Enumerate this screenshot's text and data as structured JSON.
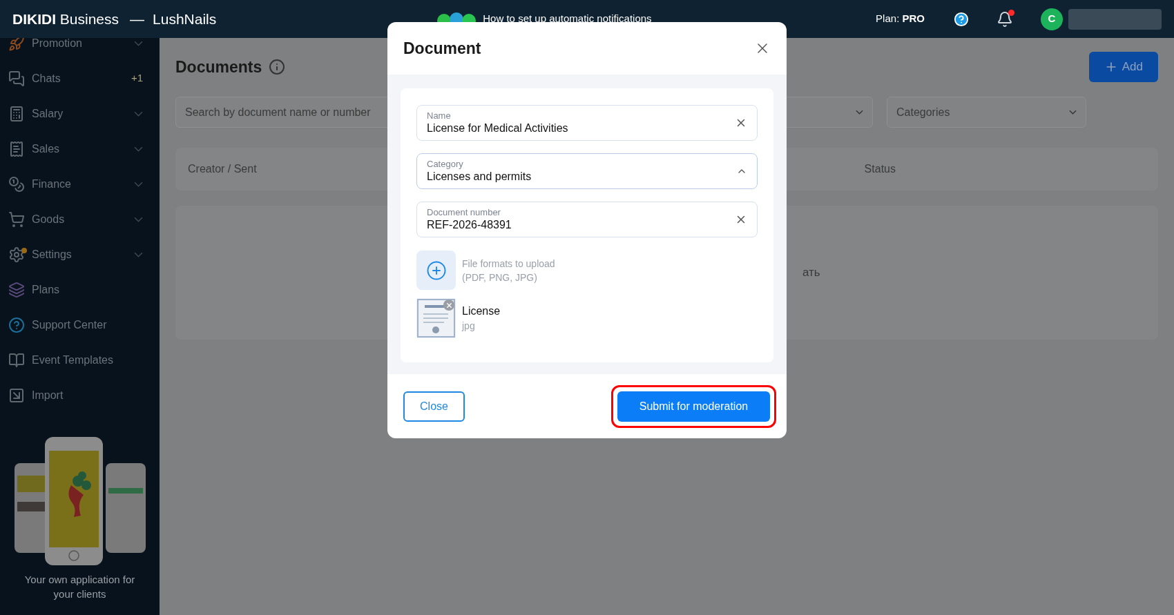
{
  "header": {
    "brand": "DIKIDI",
    "brand_suffix": "Business",
    "separator": "—",
    "company": "LushNails",
    "banner": "How to set up automatic notifications",
    "plan_label": "Plan:",
    "plan_value": "PRO",
    "notifications_unread": true,
    "avatar_initial": "C"
  },
  "sidebar": {
    "items": [
      {
        "kind": "rocket",
        "label": "Promotion",
        "expandable": true
      },
      {
        "kind": "chat",
        "label": "Chats",
        "expandable": false,
        "badge": "+1"
      },
      {
        "kind": "calc",
        "label": "Salary",
        "expandable": true
      },
      {
        "kind": "receipt",
        "label": "Sales",
        "expandable": true
      },
      {
        "kind": "coins",
        "label": "Finance",
        "expandable": true
      },
      {
        "kind": "cart",
        "label": "Goods",
        "expandable": true
      },
      {
        "kind": "gear",
        "label": "Settings",
        "expandable": true,
        "dot": true
      },
      {
        "kind": "layers",
        "label": "Plans",
        "expandable": false
      },
      {
        "kind": "help",
        "label": "Support Center",
        "expandable": false
      },
      {
        "kind": "book",
        "label": "Event Templates",
        "expandable": false
      },
      {
        "kind": "import",
        "label": "Import",
        "expandable": false
      }
    ],
    "promo": {
      "text": "Your own application for your clients"
    }
  },
  "page": {
    "title": "Documents",
    "add_button": "Add",
    "search": {
      "placeholder": "Search by document name or number"
    },
    "filters": [
      {
        "kind": "dropdown"
      },
      {
        "kind": "dropdown",
        "placeholder": "Categories"
      }
    ],
    "table": {
      "columns": [
        "Creator / Sent",
        "Status"
      ],
      "empty_text": "ать"
    }
  },
  "modal": {
    "title": "Document",
    "fields": [
      {
        "kind": "text",
        "label": "Name",
        "value": "License for Medical Activities"
      },
      {
        "kind": "select",
        "label": "Category",
        "value": "Licenses and permits",
        "expanded": true
      },
      {
        "kind": "text",
        "label": "Document number",
        "value": "REF-2026-48391"
      }
    ],
    "upload": {
      "hint": [
        "File formats to upload",
        "(PDF, PNG, JPG)"
      ]
    },
    "attachment": {
      "name": "License",
      "extension": "jpg"
    },
    "buttons": {
      "close": "Close",
      "submit": "Submit for moderation"
    },
    "submit_highlighted": true
  }
}
